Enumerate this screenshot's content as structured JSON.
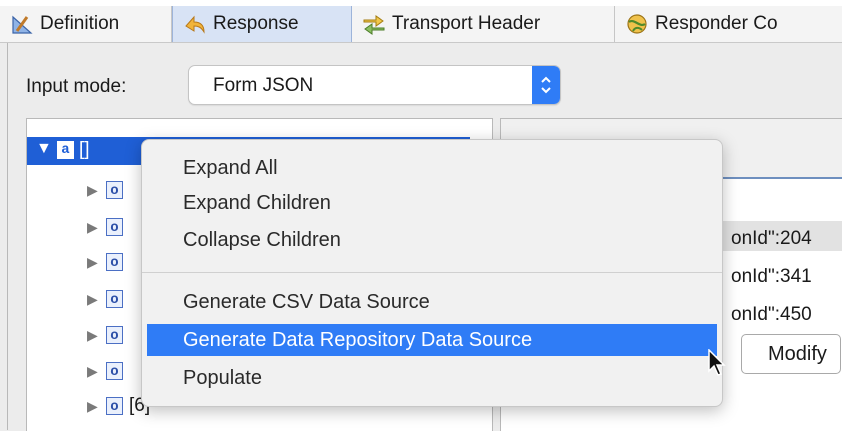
{
  "tabs": [
    {
      "label": "Definition",
      "icon": "pencil-ruler-icon",
      "active": false
    },
    {
      "label": "Response",
      "icon": "return-arrow-icon",
      "active": true
    },
    {
      "label": "Transport Header",
      "icon": "arrows-icon",
      "active": false
    },
    {
      "label": "Responder Co",
      "icon": "globe-gear-icon",
      "active": false
    }
  ],
  "input_mode": {
    "label": "Input mode:",
    "value": "Form JSON"
  },
  "tree": {
    "root_type": "a",
    "root_label": "[]",
    "row_type": "o",
    "partial_index": "[6]"
  },
  "right_panel": {
    "lines": [
      "onId\":204",
      "onId\":341",
      "onId\":450"
    ],
    "modify_label": "Modify"
  },
  "context_menu": {
    "items": [
      "Expand All",
      "Expand Children",
      "Collapse Children"
    ],
    "items2": [
      "Generate CSV Data Source",
      "Generate Data Repository Data Source",
      "Populate"
    ],
    "highlighted": "Generate Data Repository Data Source"
  },
  "colors": {
    "selection": "#1f5fd6",
    "highlight": "#2f7cf6"
  }
}
